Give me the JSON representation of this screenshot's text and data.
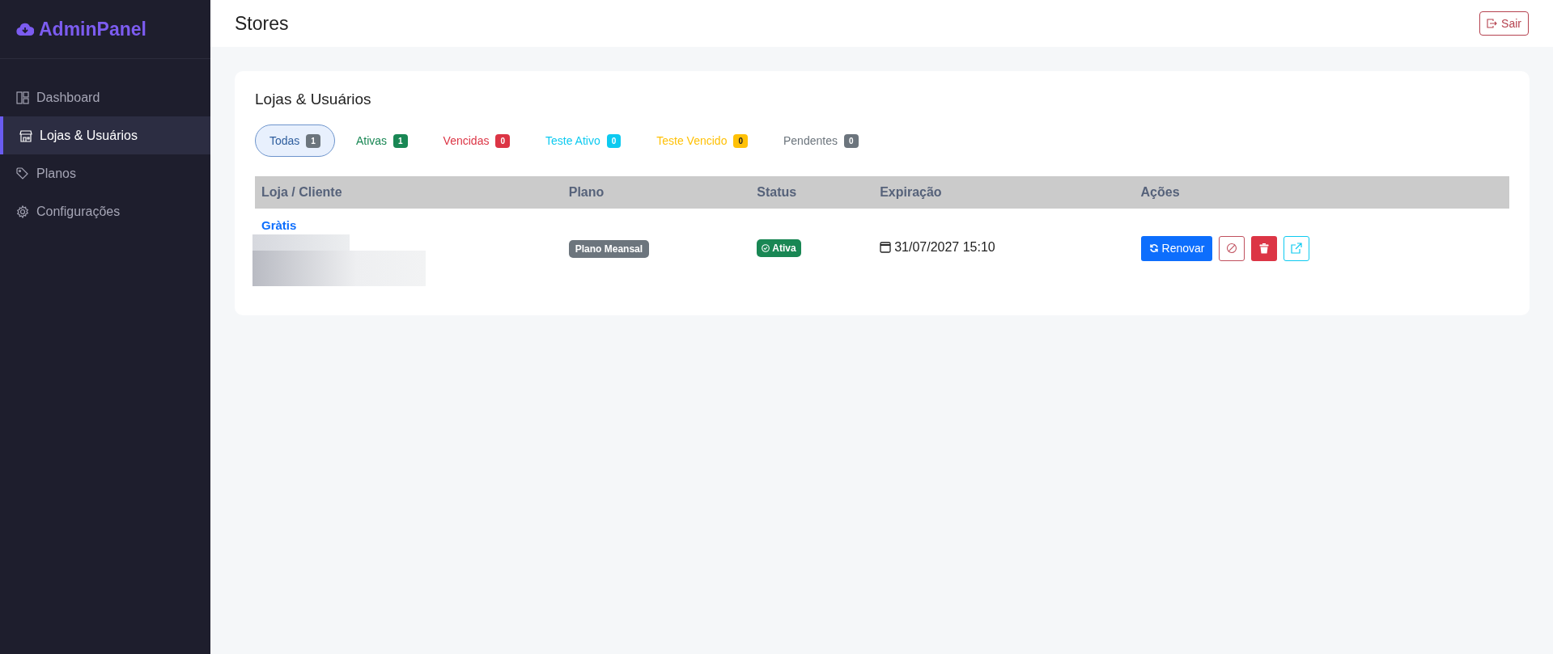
{
  "brand": {
    "name": "AdminPanel"
  },
  "sidebar": {
    "items": [
      {
        "label": "Dashboard",
        "selected": false
      },
      {
        "label": "Lojas & Usuários",
        "selected": true
      },
      {
        "label": "Planos",
        "selected": false
      },
      {
        "label": "Configurações",
        "selected": false
      }
    ]
  },
  "header": {
    "title": "Stores",
    "logout_label": "Sair"
  },
  "card": {
    "title": "Lojas & Usuários",
    "filters": [
      {
        "label": "Todas",
        "count": "1",
        "selected": true,
        "color": "#6c757d"
      },
      {
        "label": "Ativas",
        "count": "1",
        "selected": false,
        "color": "#198754"
      },
      {
        "label": "Vencidas",
        "count": "0",
        "selected": false,
        "color": "#dc3545"
      },
      {
        "label": "Teste Ativo",
        "count": "0",
        "selected": false,
        "color": "#0dcaf0"
      },
      {
        "label": "Teste Vencido",
        "count": "0",
        "selected": false,
        "color": "#ffc107"
      },
      {
        "label": "Pendentes",
        "count": "0",
        "selected": false,
        "color": "#6c757d"
      }
    ],
    "table": {
      "columns": [
        "Loja / Cliente",
        "Plano",
        "Status",
        "Expiração",
        "Ações"
      ],
      "rows": [
        {
          "store": "Gràtis",
          "plan": "Plano Meansal",
          "status": "Ativa",
          "expiration": "31/07/2027 15:10",
          "renew_label": "Renovar"
        }
      ]
    }
  }
}
